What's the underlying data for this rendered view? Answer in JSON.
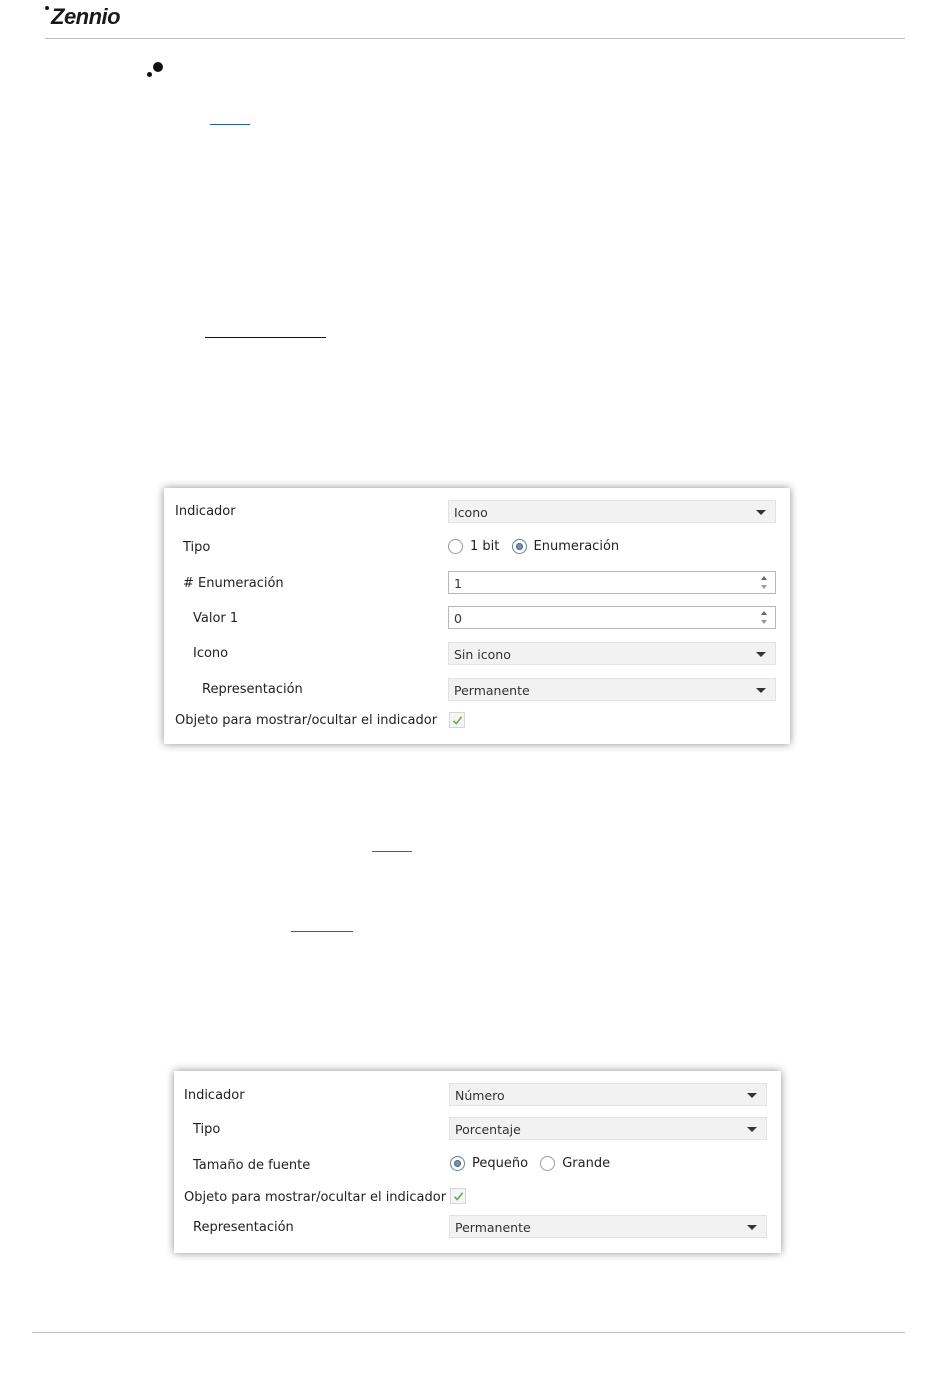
{
  "header": {
    "logo_text": "Zennio"
  },
  "colors": {
    "link_underline": "#1f5fbf",
    "check_green": "#6aa84f",
    "panel_shadow": "#7a7a7a"
  },
  "panel_icon": {
    "rows": [
      {
        "label": "Indicador",
        "control": "select",
        "value": "Icono"
      },
      {
        "label": "Tipo",
        "control": "radio",
        "options": [
          {
            "label": "1 bit",
            "selected": false
          },
          {
            "label": "Enumeración",
            "selected": true
          }
        ]
      },
      {
        "label": "# Enumeración",
        "control": "spin",
        "value": "1"
      },
      {
        "label": "Valor 1",
        "control": "spin",
        "value": "0"
      },
      {
        "label": "Icono",
        "control": "select",
        "value": "Sin icono"
      },
      {
        "label": "Representación",
        "control": "select",
        "value": "Permanente"
      },
      {
        "label": "Objeto para mostrar/ocultar el indicador",
        "control": "checkbox",
        "checked": true
      }
    ]
  },
  "panel_number": {
    "rows": [
      {
        "label": "Indicador",
        "control": "select",
        "value": "Número"
      },
      {
        "label": "Tipo",
        "control": "select",
        "value": "Porcentaje"
      },
      {
        "label": "Tamaño de fuente",
        "control": "radio",
        "options": [
          {
            "label": "Pequeño",
            "selected": true
          },
          {
            "label": "Grande",
            "selected": false
          }
        ]
      },
      {
        "label": "Objeto para mostrar/ocultar el indicador",
        "control": "checkbox",
        "checked": true
      },
      {
        "label": "Representación",
        "control": "select",
        "value": "Permanente"
      }
    ]
  }
}
